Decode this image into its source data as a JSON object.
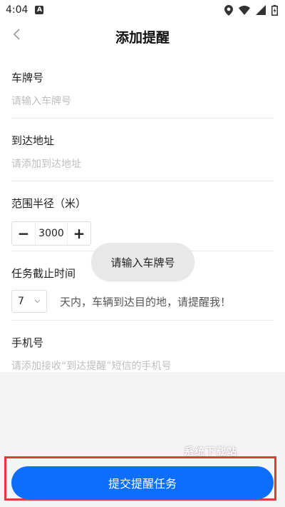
{
  "status": {
    "time": "4:04",
    "badge": "A"
  },
  "header": {
    "title": "添加提醒"
  },
  "form": {
    "plate": {
      "label": "车牌号",
      "placeholder": "请输入车牌号"
    },
    "address": {
      "label": "到达地址",
      "placeholder": "请添加到达地址"
    },
    "radius": {
      "label": "范围半径（米）",
      "value": "3000",
      "minus": "−",
      "plus": "+"
    },
    "deadline": {
      "label": "任务截止时间",
      "days": "7",
      "suffix": "天内，车辆到达目的地，请提醒我！"
    },
    "phone": {
      "label": "手机号",
      "placeholder": "请添加接收“到达提醒”短信的手机号"
    }
  },
  "toast": {
    "text": "请输入车牌号"
  },
  "submit": {
    "label": "提交提醒任务"
  },
  "watermark": {
    "text": "系统下载站"
  },
  "colors": {
    "primary": "#0d6efd",
    "highlight": "#e23a3a",
    "background": "#f4f4f4"
  }
}
